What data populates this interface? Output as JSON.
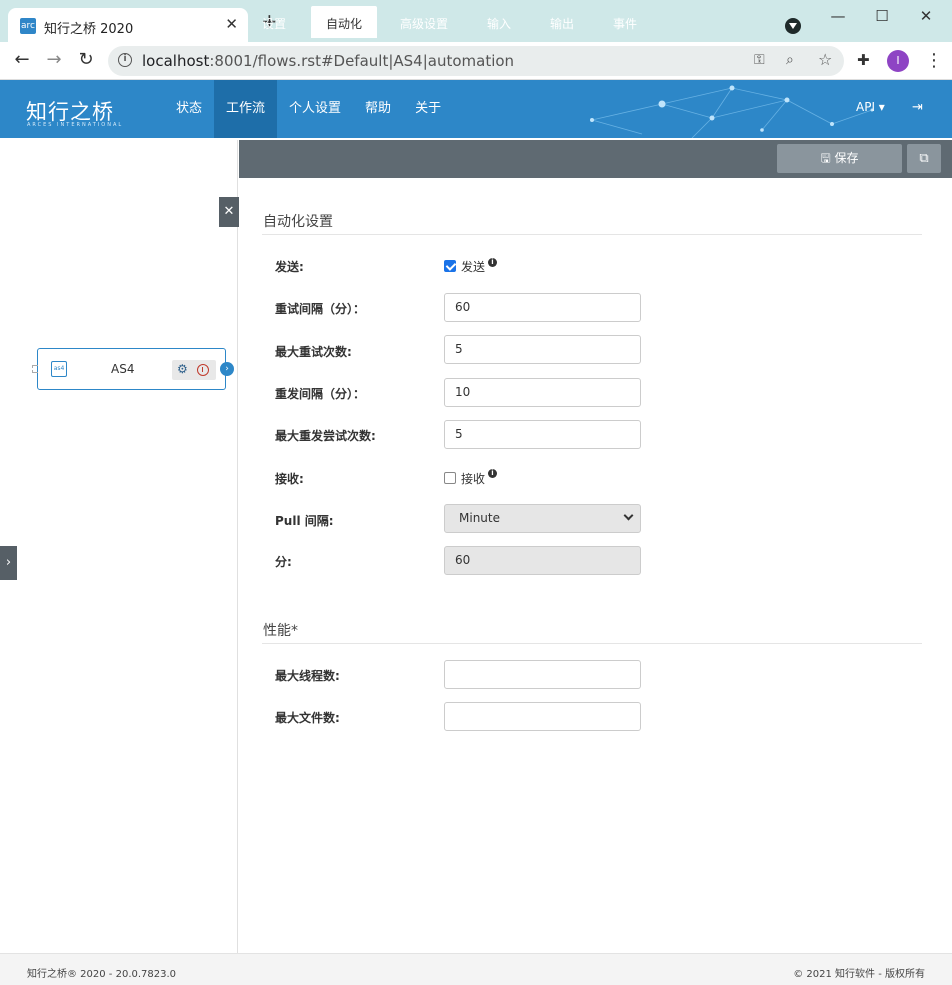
{
  "browser": {
    "tab_favicon": "arc",
    "tab_title": "知行之桥 2020",
    "tab_close": "✕",
    "new_tab": "+",
    "url_host": "localhost",
    "url_rest": ":8001/flows.rst#Default|AS4|automation",
    "profile_initial": "I"
  },
  "header": {
    "logo": "知行之桥",
    "logo_sub": "ARCES INTERNATIONAL",
    "nav": [
      "状态",
      "工作流",
      "个人设置",
      "帮助",
      "关于"
    ],
    "active_nav": "工作流",
    "api_label": "API ▾",
    "logout_icon": "logout-icon"
  },
  "canvas": {
    "node_label": "AS4",
    "node_icon": "as4"
  },
  "panel": {
    "tabs": [
      "设置",
      "自动化",
      "高级设置",
      "输入",
      "输出",
      "事件"
    ],
    "active_tab": "自动化",
    "save_label": "保存"
  },
  "automation": {
    "section_title": "自动化设置",
    "send_label": "发送:",
    "send_checkbox_label": "发送",
    "send_checked": true,
    "retry_interval_label": "重试间隔（分）：",
    "retry_interval_value": "60",
    "max_retry_label": "最大重试次数:",
    "max_retry_value": "5",
    "resend_interval_label": "重发间隔（分）：",
    "resend_interval_value": "10",
    "max_resend_label": "最大重发尝试次数:",
    "max_resend_value": "5",
    "receive_label": "接收:",
    "receive_checkbox_label": "接收",
    "receive_checked": false,
    "pull_interval_label": "Pull 间隔:",
    "pull_interval_value": "Minute",
    "minutes_label": "分:",
    "minutes_value": "60"
  },
  "performance": {
    "section_title": "性能*",
    "max_threads_label": "最大线程数:",
    "max_threads_value": "",
    "max_files_label": "最大文件数:",
    "max_files_value": ""
  },
  "footer": {
    "left": "知行之桥® 2020 - 20.0.7823.0",
    "right": "© 2021 知行软件 - 版权所有"
  },
  "colors": {
    "header_blue": "#2d87c8",
    "tabbar_gray": "#5f6a72",
    "chrome_teal": "#cfe8e8"
  }
}
